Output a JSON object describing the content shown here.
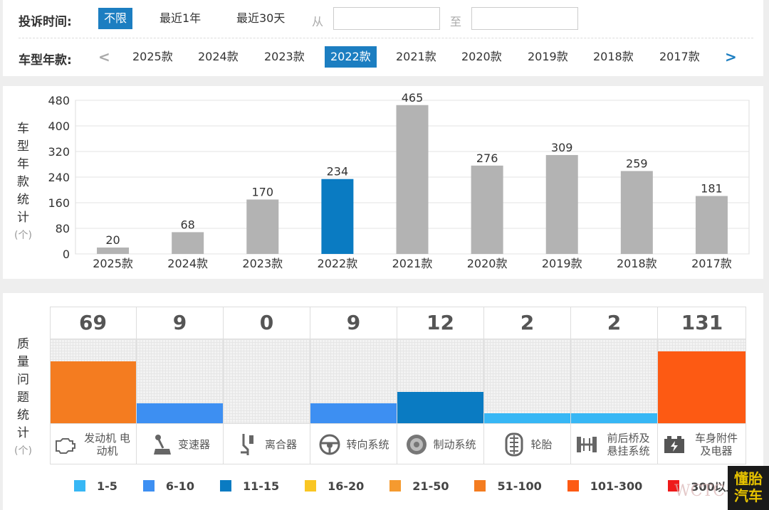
{
  "filters": {
    "time_label": "投诉时间:",
    "time_options": [
      {
        "label": "不限",
        "active": true
      },
      {
        "label": "最近1年",
        "active": false
      },
      {
        "label": "最近30天",
        "active": false
      }
    ],
    "from_label": "从",
    "to_label": "至",
    "from_value": "",
    "to_value": "",
    "year_label": "车型年款:",
    "prev_arrow": "<",
    "next_arrow": ">",
    "year_options": [
      {
        "label": "2025款",
        "active": false
      },
      {
        "label": "2024款",
        "active": false
      },
      {
        "label": "2023款",
        "active": false
      },
      {
        "label": "2022款",
        "active": true
      },
      {
        "label": "2021款",
        "active": false
      },
      {
        "label": "2020款",
        "active": false
      },
      {
        "label": "2019款",
        "active": false
      },
      {
        "label": "2018款",
        "active": false
      },
      {
        "label": "2017款",
        "active": false
      }
    ]
  },
  "chart_data": {
    "type": "bar",
    "ylabel": "车型年款统计",
    "yunit": "(个)",
    "ylim": [
      0,
      480
    ],
    "yticks": [
      "0",
      "80",
      "160",
      "240",
      "320",
      "400",
      "480"
    ],
    "categories": [
      "2025款",
      "2024款",
      "2023款",
      "2022款",
      "2021款",
      "2020款",
      "2019款",
      "2018款",
      "2017款"
    ],
    "values": [
      20,
      68,
      170,
      234,
      465,
      276,
      309,
      259,
      181
    ],
    "highlight_index": 3,
    "highlight_color": "#0a7bc2",
    "bar_color": "#b3b3b3",
    "grid": true
  },
  "quality": {
    "ylabel": "质量问题统计",
    "yunit": "(个)",
    "categories": [
      {
        "count": "69",
        "label": "发动机 电动机",
        "icon": "engine-icon",
        "color": "#f47c20",
        "level": 0.74
      },
      {
        "count": "9",
        "label": "变速器",
        "icon": "gearshift-icon",
        "color": "#3d8ff2",
        "level": 0.24
      },
      {
        "count": "0",
        "label": "离合器",
        "icon": "clutch-pedal-icon",
        "color": "#ffffff",
        "level": 0
      },
      {
        "count": "9",
        "label": "转向系统",
        "icon": "steering-wheel-icon",
        "color": "#3d8ff2",
        "level": 0.24
      },
      {
        "count": "12",
        "label": "制动系统",
        "icon": "brake-disc-icon",
        "color": "#0a7bc2",
        "level": 0.37
      },
      {
        "count": "2",
        "label": "轮胎",
        "icon": "tire-icon",
        "color": "#37b7f5",
        "level": 0.12
      },
      {
        "count": "2",
        "label": "前后桥及 悬挂系统",
        "icon": "axle-icon",
        "color": "#37b7f5",
        "level": 0.12
      },
      {
        "count": "131",
        "label": "车身附件 及电器",
        "icon": "battery-icon",
        "color": "#fd5a13",
        "level": 0.86
      }
    ],
    "legend": [
      {
        "label": "1-5",
        "color": "#37b7f5"
      },
      {
        "label": "6-10",
        "color": "#3d8ff2"
      },
      {
        "label": "11-15",
        "color": "#0a7bc2"
      },
      {
        "label": "16-20",
        "color": "#f9c623"
      },
      {
        "label": "21-50",
        "color": "#f59a2f"
      },
      {
        "label": "51-100",
        "color": "#f47c20"
      },
      {
        "label": "101-300",
        "color": "#fd5a13"
      },
      {
        "label": "300以上",
        "color": "#ef1a1a"
      }
    ]
  },
  "watermark": {
    "text": "WCTC",
    "badge": "懂胎 汽车"
  }
}
